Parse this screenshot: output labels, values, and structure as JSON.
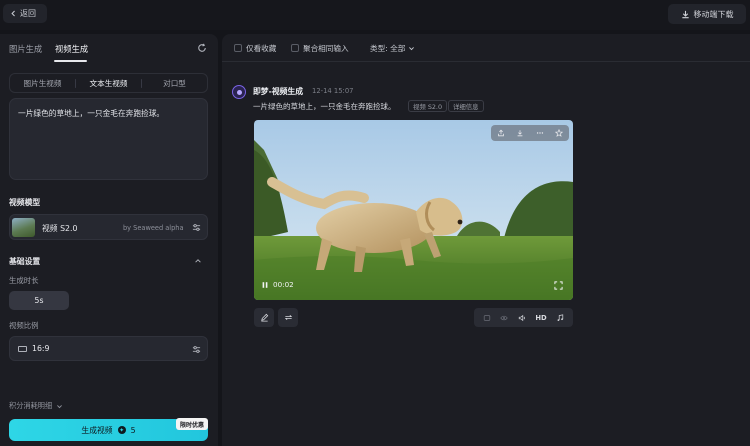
{
  "topbar": {
    "back_label": "返回",
    "mobile_download_label": "移动端下载"
  },
  "left": {
    "tabs": [
      {
        "label": "图片生成"
      },
      {
        "label": "视频生成"
      }
    ],
    "segments": [
      {
        "label": "图片生视频"
      },
      {
        "label": "文本生视频"
      },
      {
        "label": "对口型"
      }
    ],
    "prompt_value": "一片绿色的草地上，一只金毛在奔跑捡球。",
    "model_section_title": "视频模型",
    "model": {
      "name": "视频 S2.0",
      "provider": "by Seaweed alpha"
    },
    "basic_settings_title": "基础设置",
    "duration_label": "生成时长",
    "duration_value": "5s",
    "ratio_label": "视频比例",
    "ratio_value": "16:9",
    "points_label": "积分消耗明细",
    "generate_label": "生成视频",
    "generate_cost": "5",
    "promo_badge": "限时优惠"
  },
  "right": {
    "filters": {
      "favorites_label": "仅看收藏",
      "merge_label": "聚合相同输入",
      "type_label": "类型: 全部"
    },
    "message": {
      "title": "即梦-视频生成",
      "time": "12-14  15:07",
      "text": "一片绿色的草地上，一只金毛在奔跑捡球。",
      "model_chip": "视频 S2.0",
      "detail_chip": "详细信息"
    },
    "video": {
      "timestamp": "00:02"
    },
    "tools": {
      "hd_label": "HD"
    }
  },
  "colors": {
    "accent": "#2ed6e6",
    "avatar": "#7a63e6",
    "panel": "#1c1d23",
    "background": "#14151a"
  }
}
